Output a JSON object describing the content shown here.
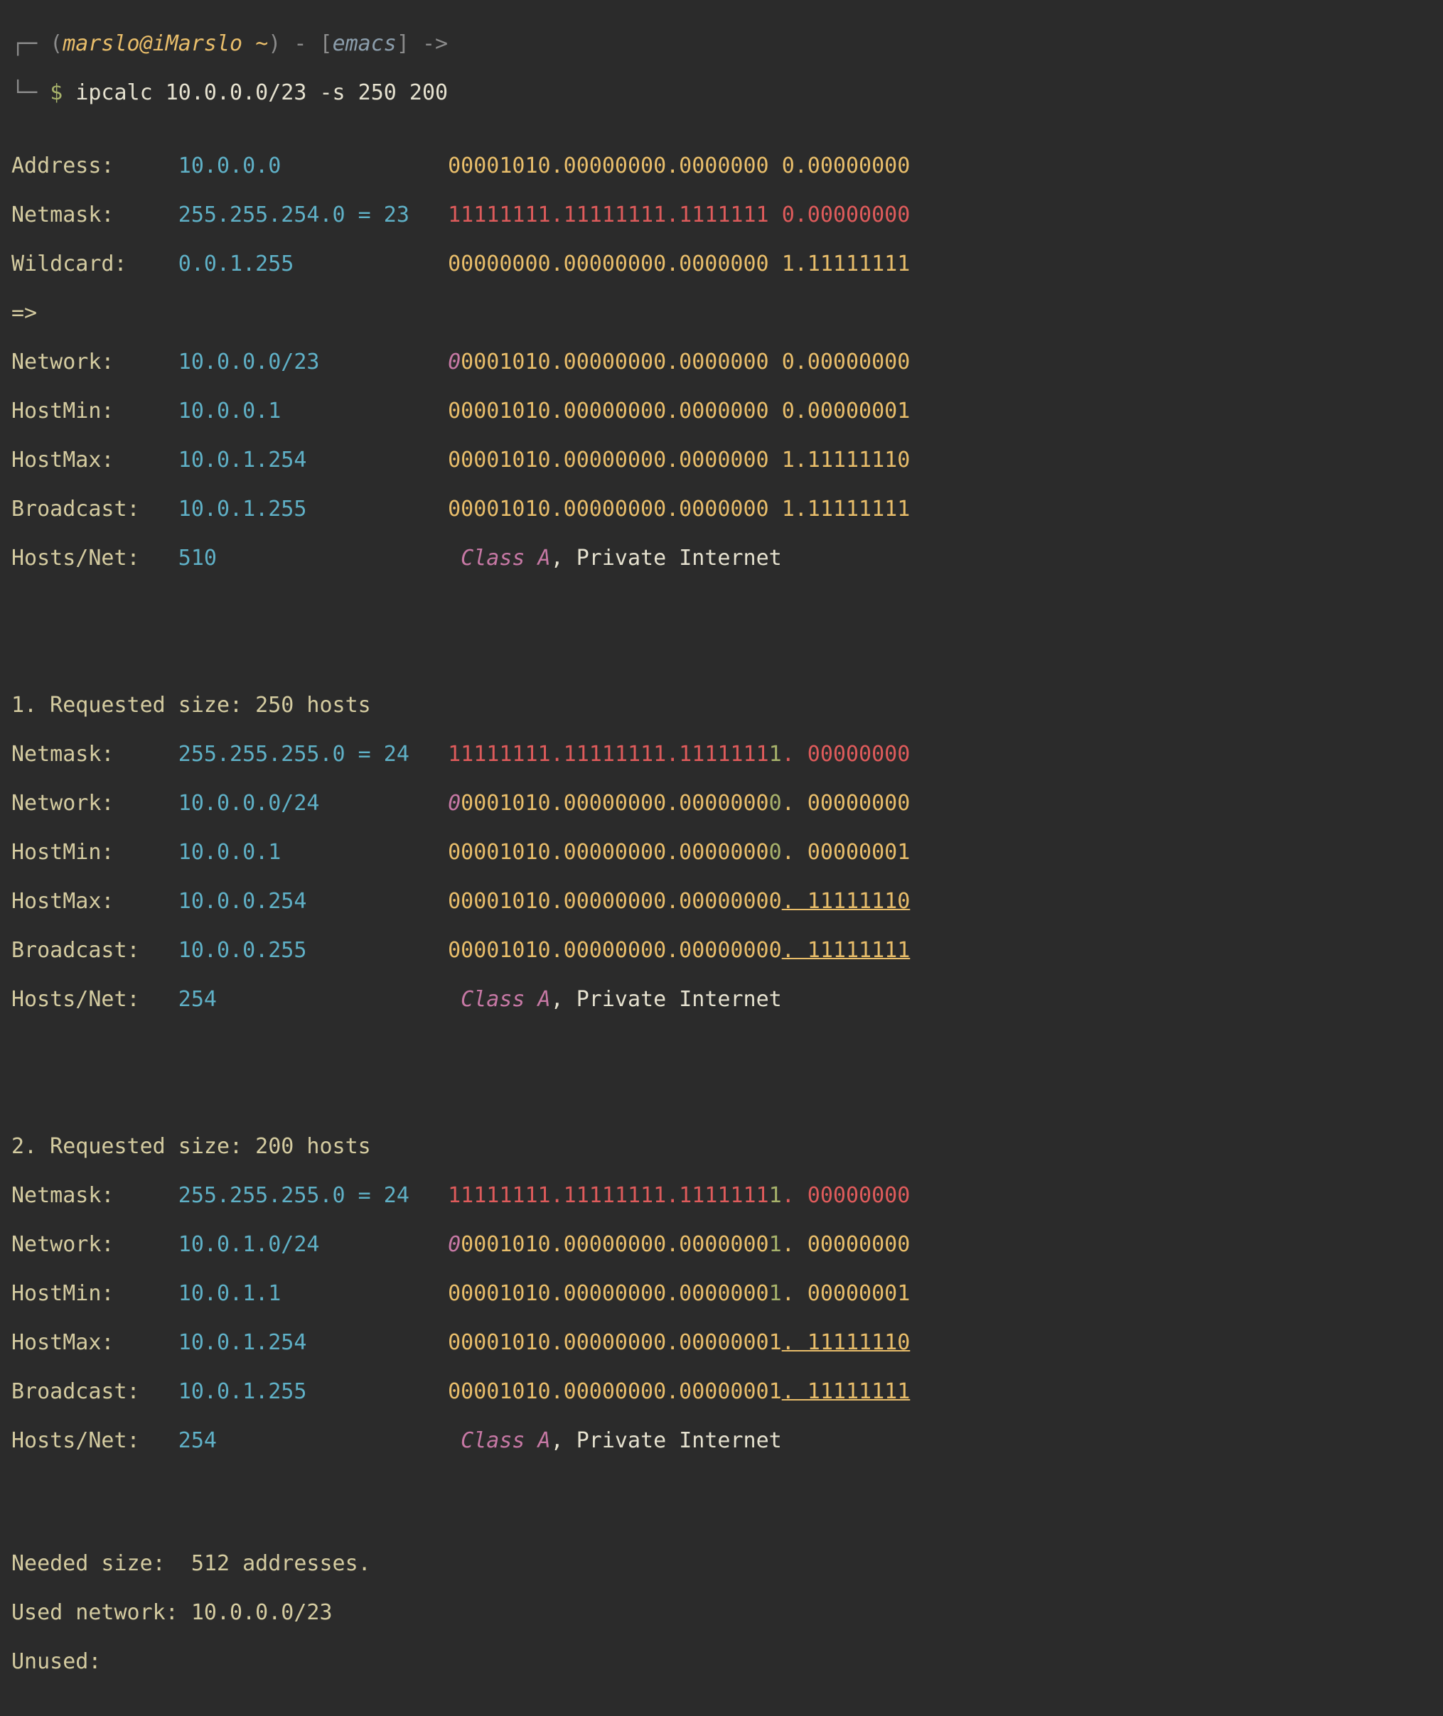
{
  "prompt": {
    "user_host": "marslo@iMarslo",
    "path": "~",
    "app": "emacs",
    "arrow": "->",
    "dollar": "$",
    "command": "ipcalc 10.0.0.0/23 -s 250 200"
  },
  "main": {
    "address": {
      "label": "Address:",
      "value": "10.0.0.0",
      "bits_net": "00001010.00000000.0000000",
      "bits_sep": "0",
      "bits_host": ".00000000"
    },
    "netmask": {
      "label": "Netmask:",
      "value": "255.255.254.0 = 23",
      "bits_net": "11111111.11111111.1111111",
      "bits_sep": "0",
      "bits_host": ".00000000"
    },
    "wildcard": {
      "label": "Wildcard:",
      "value": "0.0.1.255",
      "bits_net": "00000000.00000000.0000000",
      "bits_sep": "1",
      "bits_host": ".11111111"
    },
    "arrow": "=>",
    "network": {
      "label": "Network:",
      "value": "10.0.0.0/23",
      "bits_first": "0",
      "bits_net": "0001010.00000000.0000000",
      "bits_sep": "0",
      "bits_host": ".00000000"
    },
    "hostmin": {
      "label": "HostMin:",
      "value": "10.0.0.1",
      "bits_net": "00001010.00000000.0000000",
      "bits_sep": "0",
      "bits_host": ".00000001"
    },
    "hostmax": {
      "label": "HostMax:",
      "value": "10.0.1.254",
      "bits_net": "00001010.00000000.0000000",
      "bits_sep": "1",
      "bits_host": ".11111110"
    },
    "broadcast": {
      "label": "Broadcast:",
      "value": "10.0.1.255",
      "bits_net": "00001010.00000000.0000000",
      "bits_sep": "1",
      "bits_host": ".11111111"
    },
    "hosts": {
      "label": "Hosts/Net:",
      "value": "510",
      "class": "Class A",
      "note": ", Private Internet"
    }
  },
  "sections": [
    {
      "title": "1. Requested size: 250 hosts",
      "netmask": {
        "label": "Netmask:",
        "value": "255.255.255.0 = 24",
        "bits_net": "11111111.11111111.1111111",
        "bits_last": "1",
        "bits_host": ". 00000000"
      },
      "network": {
        "label": "Network:",
        "value": "10.0.0.0/24",
        "bits_first": "0",
        "bits_net": "0001010.00000000.0000000",
        "bits_last": "0",
        "bits_host": ". 00000000"
      },
      "hostmin": {
        "label": "HostMin:",
        "value": "10.0.0.1",
        "bits_net": "00001010.00000000.0000000",
        "bits_last": "0",
        "bits_host": ". 00000001"
      },
      "hostmax": {
        "label": "HostMax:",
        "value": "10.0.0.254",
        "bits_net": "00001010.00000000.00000000",
        "bits_host": ". 11111110"
      },
      "broadcast": {
        "label": "Broadcast:",
        "value": "10.0.0.255",
        "bits_net": "00001010.00000000.00000000",
        "bits_host": ". 11111111"
      },
      "hosts": {
        "label": "Hosts/Net:",
        "value": "254",
        "class": "Class A",
        "note": ", Private Internet"
      }
    },
    {
      "title": "2. Requested size: 200 hosts",
      "netmask": {
        "label": "Netmask:",
        "value": "255.255.255.0 = 24",
        "bits_net": "11111111.11111111.1111111",
        "bits_last": "1",
        "bits_host": ". 00000000"
      },
      "network": {
        "label": "Network:",
        "value": "10.0.1.0/24",
        "bits_first": "0",
        "bits_net": "0001010.00000000.0000000",
        "bits_last": "1",
        "bits_host": ". 00000000"
      },
      "hostmin": {
        "label": "HostMin:",
        "value": "10.0.1.1",
        "bits_net": "00001010.00000000.0000000",
        "bits_last": "1",
        "bits_host": ". 00000001"
      },
      "hostmax": {
        "label": "HostMax:",
        "value": "10.0.1.254",
        "bits_net": "00001010.00000000.00000001",
        "bits_host": ". 11111110"
      },
      "broadcast": {
        "label": "Broadcast:",
        "value": "10.0.1.255",
        "bits_net": "00001010.00000000.00000001",
        "bits_host": ". 11111111"
      },
      "hosts": {
        "label": "Hosts/Net:",
        "value": "254",
        "class": "Class A",
        "note": ", Private Internet"
      }
    }
  ],
  "summary": {
    "needed": {
      "label": "Needed size:",
      "value": "512 addresses."
    },
    "used": {
      "label": "Used network:",
      "value": "10.0.0.0/23"
    },
    "unused": {
      "label": "Unused:"
    }
  }
}
